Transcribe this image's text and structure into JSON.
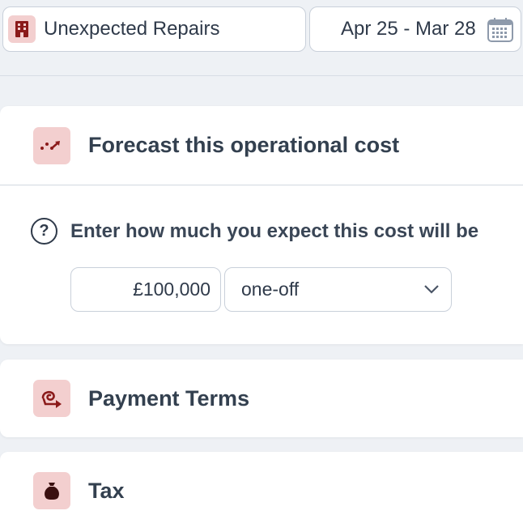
{
  "header": {
    "cost_name": "Unexpected Repairs",
    "date_range": "Apr 25 - Mar 28",
    "cost_icon": "building-icon",
    "date_icon": "calendar-icon"
  },
  "forecast": {
    "title": "Forecast this operational cost",
    "icon": "trend-icon",
    "help_icon": "question-icon",
    "question": "Enter how much you expect this cost will be",
    "amount": "£100,000",
    "frequency": "one-off"
  },
  "payment_terms": {
    "title": "Payment Terms",
    "icon": "payment-terms-icon"
  },
  "tax": {
    "title": "Tax",
    "icon": "money-bag-icon"
  },
  "colors": {
    "accent_icon": "#8b1a1a",
    "icon_badge_bg": "#f3cfcf",
    "page_bg": "#eef1f5",
    "text": "#2f3a4a"
  }
}
